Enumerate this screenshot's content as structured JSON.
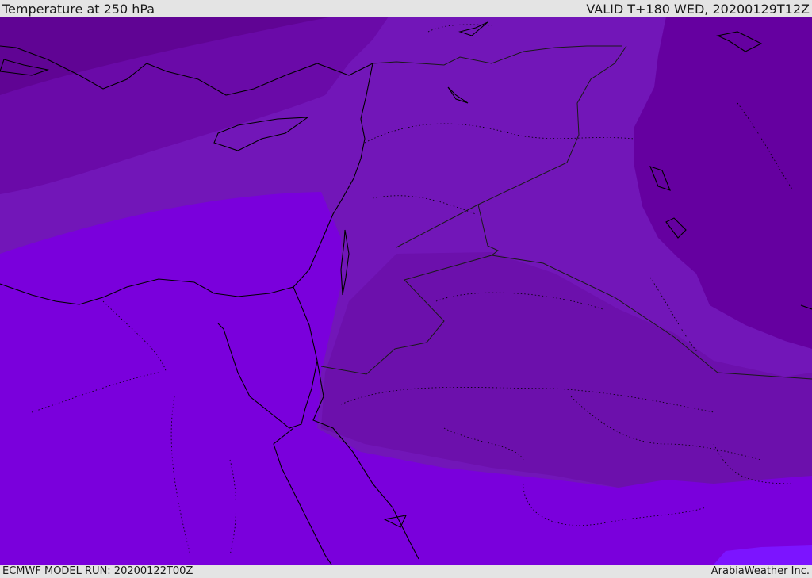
{
  "header": {
    "title": "Temperature at 250 hPa",
    "valid": "VALID T+180 WED, 20200129T12Z"
  },
  "footer": {
    "model_run": "ECMWF MODEL RUN: 20200122T00Z",
    "credit": "ArabiaWeather Inc."
  },
  "map": {
    "variable": "temperature",
    "level_hpa": 250,
    "colors": {
      "band_1": "#7a00dc",
      "band_2": "#7216b8",
      "band_3": "#6a0aa8",
      "band_4": "#600494",
      "band_5": "#6500a0",
      "band_6": "#7c14ff",
      "coast_line": "#000000",
      "border_line": "#1a1a1a"
    }
  }
}
